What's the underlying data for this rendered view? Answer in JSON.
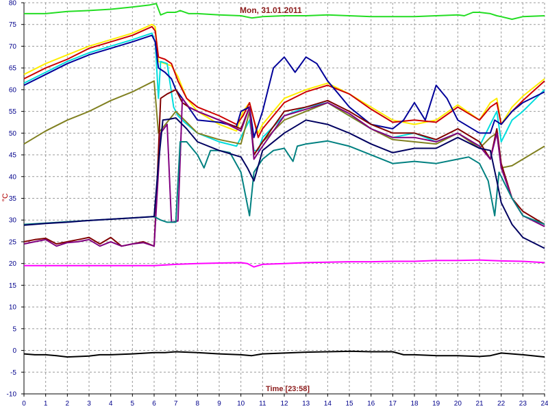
{
  "chart_data": {
    "type": "line",
    "title": "Mon, 31.01.2011",
    "xlabel": "Time [23:58]",
    "ylabel": "°C",
    "xlim": [
      0,
      24
    ],
    "ylim": [
      -10,
      80
    ],
    "xticks": [
      "0",
      "1",
      "2",
      "3",
      "4",
      "5",
      "6",
      "7",
      "8",
      "9",
      "10",
      "11",
      "12",
      "13",
      "14",
      "15",
      "16",
      "17",
      "18",
      "19",
      "20",
      "21",
      "22",
      "23",
      "24"
    ],
    "yticks": [
      "-10",
      "-5",
      "0",
      "5",
      "10",
      "15",
      "20",
      "25",
      "30",
      "35",
      "40",
      "45",
      "50",
      "55",
      "60",
      "65",
      "70",
      "75",
      "80"
    ],
    "grid": true,
    "series": [
      {
        "color": "#22dd22",
        "x": [
          0,
          1,
          2,
          3,
          4,
          5,
          5.8,
          6.1,
          6.3,
          6.6,
          7,
          7.2,
          7.6,
          8,
          9,
          10,
          10.5,
          11,
          12,
          13,
          14,
          15,
          16,
          17,
          18,
          19,
          20,
          20.3,
          20.7,
          21,
          21.5,
          21.8,
          22,
          22.5,
          23,
          24
        ],
        "y": [
          77.5,
          77.5,
          78,
          78.2,
          78.5,
          79,
          79.5,
          79.8,
          77.2,
          77.8,
          77.8,
          78.2,
          77.5,
          77.5,
          77.2,
          77,
          76.5,
          76.8,
          77,
          77,
          77.2,
          77,
          76.8,
          76.8,
          76.8,
          77,
          77.2,
          77,
          77.8,
          77.8,
          77.5,
          77,
          76.8,
          76.2,
          76.8,
          77
        ]
      },
      {
        "color": "#ff00ff",
        "x": [
          0,
          2,
          4,
          5,
          6,
          7,
          8,
          9,
          10,
          10.3,
          10.6,
          11,
          12,
          13,
          14,
          15,
          16,
          17,
          18,
          19,
          20,
          21,
          22,
          23,
          24
        ],
        "y": [
          19.5,
          19.5,
          19.5,
          19.5,
          19.5,
          19.8,
          20,
          20.1,
          20.2,
          20,
          19.2,
          19.8,
          20,
          20.2,
          20.3,
          20.4,
          20.4,
          20.5,
          20.5,
          20.7,
          20.7,
          20.8,
          20.6,
          20.5,
          20.2
        ]
      },
      {
        "color": "#000000",
        "x": [
          0,
          0.5,
          1,
          1.5,
          2,
          3,
          3.5,
          4,
          5,
          6,
          6.5,
          7,
          8,
          9,
          10,
          10.5,
          11,
          12,
          13,
          14,
          15,
          16,
          17,
          17.5,
          18,
          19,
          20,
          21,
          21.5,
          22,
          23,
          24
        ],
        "y": [
          -0.8,
          -1,
          -1,
          -1.2,
          -1.5,
          -1.3,
          -1,
          -1,
          -0.8,
          -0.5,
          -0.5,
          -0.3,
          -0.5,
          -0.8,
          -1,
          -1.2,
          -0.8,
          -0.6,
          -0.4,
          -0.3,
          -0.2,
          -0.3,
          -0.3,
          -1,
          -1,
          -1.2,
          -1.2,
          -1.4,
          -1.2,
          -0.6,
          -1,
          -1.5
        ]
      },
      {
        "color": "#ffee00",
        "x": [
          0,
          1,
          2,
          3,
          4,
          5,
          5.9,
          6.05,
          6.2,
          6.5,
          6.8,
          7.1,
          7.5,
          8,
          9,
          9.8,
          10.1,
          10.4,
          10.6,
          10.8,
          11,
          12,
          13,
          14,
          15,
          16,
          17,
          18,
          19,
          20,
          21,
          21.5,
          21.8,
          22,
          22.5,
          23,
          24
        ],
        "y": [
          63.5,
          66,
          68,
          70,
          71.5,
          73,
          75,
          74.5,
          66.5,
          66,
          65.5,
          63,
          58,
          55,
          52,
          50.5,
          55,
          57,
          53,
          50,
          52,
          58,
          60,
          61.5,
          59,
          56,
          53,
          52,
          53,
          56.5,
          53,
          57,
          58,
          52,
          56,
          58.5,
          62.5
        ]
      },
      {
        "color": "#cc0000",
        "x": [
          0,
          1,
          2,
          3,
          4,
          5,
          5.9,
          6.05,
          6.2,
          6.5,
          6.8,
          7.1,
          7.5,
          8,
          9,
          9.8,
          10.1,
          10.4,
          10.6,
          10.8,
          11,
          12,
          13,
          14,
          15,
          16,
          17,
          18,
          19,
          20,
          21,
          21.5,
          21.8,
          22,
          22.5,
          23,
          24
        ],
        "y": [
          62.5,
          65,
          67,
          69.5,
          71,
          72.5,
          74.5,
          73.5,
          67.5,
          67,
          66,
          62,
          58,
          56,
          54,
          52,
          54,
          57,
          53,
          49,
          51,
          57,
          59.5,
          61,
          59,
          55.5,
          52.5,
          53,
          52.5,
          56,
          53,
          56,
          57,
          52,
          55,
          57.5,
          62
        ]
      },
      {
        "color": "#00dddd",
        "x": [
          0,
          1,
          2,
          3,
          4,
          5,
          5.9,
          6.05,
          6.2,
          6.3,
          6.6,
          6.9,
          7.1,
          7.4,
          8,
          9,
          9.8,
          10.1,
          10.4,
          10.6,
          10.8,
          11,
          12,
          13,
          14,
          15,
          16,
          17,
          18,
          19,
          20,
          21,
          21.5,
          21.8,
          22,
          22.5,
          23,
          24
        ],
        "y": [
          61.5,
          64,
          66.5,
          68.5,
          70,
          71.5,
          73,
          71,
          58,
          66.5,
          66,
          56,
          54,
          52.5,
          50,
          48,
          47,
          50,
          53,
          46,
          46,
          49,
          54,
          56,
          57,
          54,
          51,
          49,
          50,
          48,
          50,
          47,
          52,
          55,
          48,
          53,
          55,
          60
        ]
      },
      {
        "color": "#000099",
        "x": [
          0,
          1,
          2,
          3,
          4,
          5,
          5.9,
          6.05,
          6.2,
          6.5,
          6.8,
          7,
          7.3,
          8,
          9,
          9.8,
          10,
          10.4,
          10.6,
          11,
          11.5,
          12,
          12.5,
          13,
          13.5,
          14,
          14.5,
          15,
          16,
          17,
          17.5,
          18,
          18.5,
          19,
          19.5,
          20,
          21,
          21.5,
          21.7,
          22,
          22.5,
          23,
          24
        ],
        "y": [
          61,
          63.5,
          66,
          68,
          69.5,
          71,
          72.5,
          71,
          65,
          64,
          62.5,
          60,
          58,
          53,
          52.5,
          51.5,
          55,
          56,
          49,
          55,
          65,
          67.5,
          64,
          67.5,
          66,
          62,
          59,
          56,
          52,
          51,
          53,
          57,
          53,
          61,
          58,
          53,
          50,
          50,
          53,
          52,
          55,
          57,
          59.5
        ]
      },
      {
        "color": "#808020",
        "x": [
          0,
          1,
          2,
          3,
          4,
          5,
          6,
          6.2,
          6.6,
          7,
          7.5,
          8,
          9,
          10,
          10.4,
          10.6,
          11,
          12,
          13,
          14,
          15,
          16,
          17,
          18,
          19,
          20,
          21,
          21.5,
          21.8,
          22,
          22.5,
          23,
          24
        ],
        "y": [
          47.5,
          50.5,
          53,
          55,
          57.5,
          59.5,
          62,
          50,
          52.5,
          55,
          52.5,
          50,
          48.5,
          47.5,
          55,
          45,
          48,
          53,
          55,
          57,
          54,
          51,
          48.5,
          48,
          47.5,
          50,
          46.5,
          49,
          50,
          42,
          42.5,
          44,
          47
        ]
      },
      {
        "color": "#800000",
        "x": [
          0,
          0.5,
          1,
          1.5,
          2,
          2.5,
          3,
          3.5,
          4,
          4.5,
          5,
          5.5,
          6,
          6.1,
          6.3,
          6.6,
          7,
          7.3,
          7.6,
          8,
          9,
          10,
          10.4,
          10.6,
          11,
          12,
          13,
          14,
          15,
          16,
          17,
          18,
          19,
          20,
          21,
          21.5,
          21.8,
          22,
          22.5,
          23,
          24
        ],
        "y": [
          25,
          25.5,
          25.8,
          24.5,
          25,
          25.5,
          26,
          24.5,
          26,
          24,
          24.5,
          25,
          24,
          34,
          58,
          59,
          60,
          57,
          56,
          55,
          53,
          51,
          56,
          45,
          48,
          55,
          56,
          57.5,
          55,
          52,
          50,
          50,
          48.5,
          51,
          48,
          44,
          51,
          43,
          35,
          32,
          29
        ]
      },
      {
        "color": "#800080",
        "x": [
          0,
          0.5,
          1,
          1.5,
          2,
          2.5,
          3,
          3.5,
          4,
          4.5,
          5,
          5.5,
          6,
          6.3,
          6.6,
          6.8,
          7.1,
          7.3,
          7.6,
          8,
          9,
          10,
          10.4,
          10.6,
          11,
          12,
          13,
          14,
          15,
          16,
          17,
          18,
          19,
          20,
          21,
          21.5,
          21.8,
          22,
          22.5,
          23,
          24
        ],
        "y": [
          24.5,
          25,
          25.5,
          24,
          24.8,
          25,
          25.5,
          24,
          25,
          24,
          24.5,
          24.8,
          24,
          50,
          52,
          29.5,
          29.8,
          58,
          56,
          55,
          53,
          50.5,
          56,
          44,
          47,
          54,
          55.5,
          57,
          54.5,
          51,
          49,
          49,
          48,
          50,
          47,
          44,
          50,
          42,
          35,
          31,
          28.5
        ]
      },
      {
        "color": "#008080",
        "x": [
          0,
          1,
          2,
          3,
          4,
          5,
          6,
          6.3,
          6.6,
          7,
          7.2,
          7.5,
          8,
          8.3,
          8.6,
          9,
          9.5,
          10,
          10.2,
          10.4,
          10.6,
          11,
          11.5,
          12,
          12.4,
          12.6,
          13,
          14,
          15,
          16,
          17,
          18,
          19,
          20,
          20.5,
          21,
          21.4,
          21.7,
          21.9,
          22.2,
          22.5,
          23,
          24
        ],
        "y": [
          29,
          29.3,
          29.6,
          29.9,
          30.2,
          30.5,
          30.8,
          30,
          29.5,
          29.5,
          48,
          48,
          45,
          42,
          46,
          46,
          45.5,
          41,
          36,
          31,
          41,
          44,
          46,
          46.5,
          43.5,
          47,
          47.5,
          48.2,
          47,
          45,
          43,
          43.5,
          43,
          44,
          44.5,
          43,
          39,
          31,
          41,
          38,
          35,
          31,
          29
        ]
      },
      {
        "color": "#000060",
        "x": [
          0,
          1,
          2,
          3,
          4,
          5,
          6,
          6.2,
          6.4,
          6.7,
          7,
          7.2,
          7.5,
          8,
          9,
          10,
          10.3,
          10.6,
          11,
          12,
          13,
          14,
          15,
          16,
          17,
          18,
          19,
          20,
          21,
          21.5,
          21.8,
          22,
          22.5,
          23,
          24
        ],
        "y": [
          28.8,
          29.2,
          29.5,
          29.9,
          30.2,
          30.5,
          30.8,
          43,
          53,
          53.2,
          53.5,
          52.5,
          51,
          48,
          46,
          44.5,
          42,
          39,
          46,
          50,
          53,
          52,
          50,
          47.5,
          45.5,
          46.5,
          46.5,
          49,
          46.5,
          46,
          39,
          34,
          29,
          26,
          23.5
        ]
      }
    ]
  }
}
